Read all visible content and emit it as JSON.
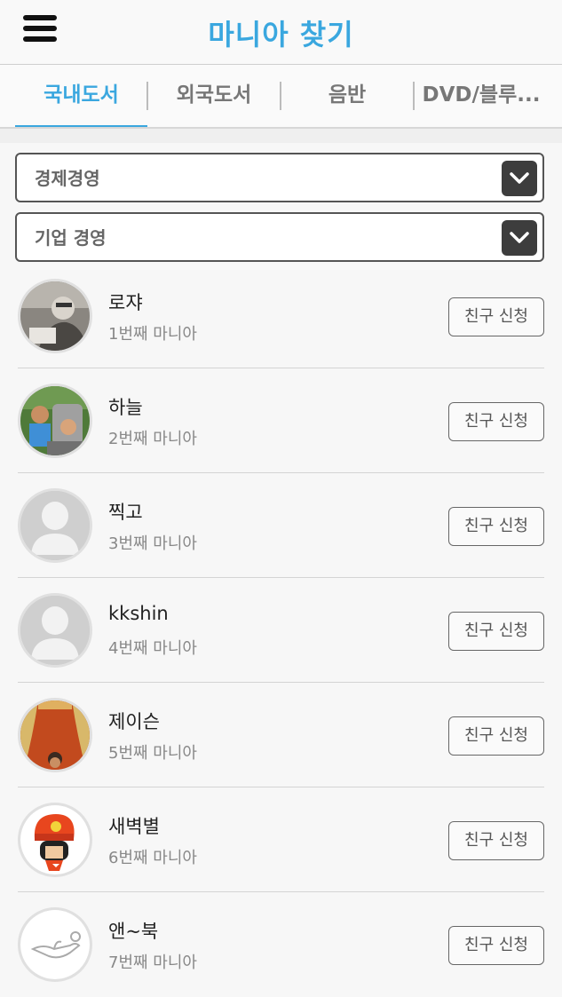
{
  "header": {
    "title": "마니아 찾기",
    "menu_icon": "hamburger-menu-icon",
    "accent_color": "#3aa7df"
  },
  "tabs": [
    {
      "label": "국내도서",
      "active": true
    },
    {
      "label": "외국도서",
      "active": false
    },
    {
      "label": "음반",
      "active": false
    },
    {
      "label": "DVD/블루...",
      "active": false
    }
  ],
  "filters": {
    "category": {
      "value": "경제경영",
      "icon": "chevron-down-icon"
    },
    "subcategory": {
      "value": "기업 경영",
      "icon": "chevron-down-icon"
    }
  },
  "users": [
    {
      "name": "로쟈",
      "rank": "1번째 마니아",
      "button": "친구 신청",
      "avatar": "photo-reading-man"
    },
    {
      "name": "하늘",
      "rank": "2번째 마니아",
      "button": "친구 신청",
      "avatar": "photo-children"
    },
    {
      "name": "찍고",
      "rank": "3번째 마니아",
      "button": "친구 신청",
      "avatar": "default-avatar"
    },
    {
      "name": "kkshin",
      "rank": "4번째 마니아",
      "button": "친구 신청",
      "avatar": "default-avatar"
    },
    {
      "name": "제이슨",
      "rank": "5번째 마니아",
      "button": "친구 신청",
      "avatar": "photo-curtain"
    },
    {
      "name": "새벽별",
      "rank": "6번째 마니아",
      "button": "친구 신청",
      "avatar": "cartoon-character"
    },
    {
      "name": "앤~북",
      "rank": "7번째 마니아",
      "button": "친구 신청",
      "avatar": "lamp-drawing"
    }
  ]
}
